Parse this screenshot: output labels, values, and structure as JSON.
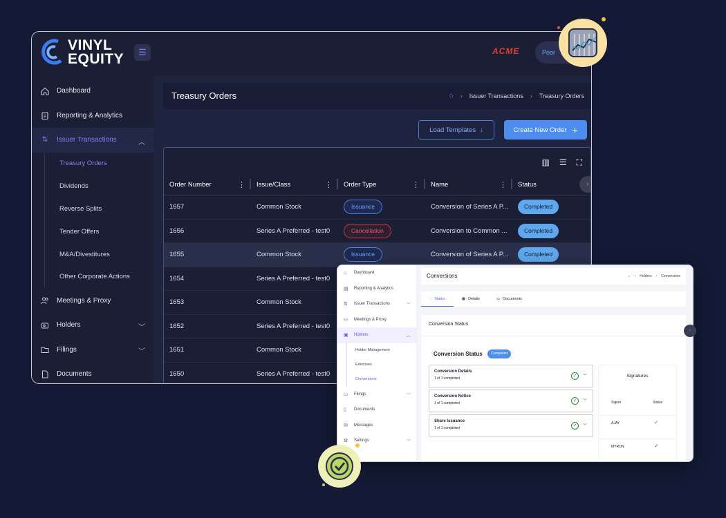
{
  "app": {
    "logo_line1": "VINYL",
    "logo_line2": "EQUITY",
    "client_brand": "ACME",
    "user_label": "Poor"
  },
  "sidebar": {
    "items": [
      {
        "label": "Dashboard",
        "icon": "home-icon"
      },
      {
        "label": "Reporting & Analytics",
        "icon": "clipboard-icon"
      },
      {
        "label": "Issuer Transactions",
        "icon": "transfer-arrows-icon",
        "expanded": true
      },
      {
        "label": "Meetings & Proxy",
        "icon": "people-icon"
      },
      {
        "label": "Holders",
        "icon": "holders-icon"
      },
      {
        "label": "Filings",
        "icon": "folder-icon"
      },
      {
        "label": "Documents",
        "icon": "document-icon"
      }
    ],
    "issuer_sub": [
      "Treasury Orders",
      "Dividends",
      "Reverse Splits",
      "Tender Offers",
      "M&A/Divestitures",
      "Other Corporate Actions"
    ]
  },
  "page": {
    "title": "Treasury Orders",
    "breadcrumb": [
      "Issuer Transactions",
      "Treasury Orders"
    ],
    "load_templates": "Load Templates",
    "create_order": "Create New Order"
  },
  "table": {
    "columns": [
      "Order Number",
      "Issue/Class",
      "Order Type",
      "Name",
      "Status"
    ],
    "rows": [
      {
        "order": "1657",
        "issue": "Common Stock",
        "type": "Issuance",
        "name": "Conversion of Series A P...",
        "status": "Completed"
      },
      {
        "order": "1656",
        "issue": "Series A Preferred - test0",
        "type": "Cancellation",
        "name": "Conversion to Common ...",
        "status": "Completed"
      },
      {
        "order": "1655",
        "issue": "Common Stock",
        "type": "Issuance",
        "name": "Conversion of Series A P...",
        "status": "Completed"
      },
      {
        "order": "1654",
        "issue": "Series A Preferred - test0"
      },
      {
        "order": "1653",
        "issue": "Common Stock"
      },
      {
        "order": "1652",
        "issue": "Series A Preferred - test0"
      },
      {
        "order": "1651",
        "issue": "Common Stock"
      },
      {
        "order": "1650",
        "issue": "Series A Preferred - test0"
      }
    ]
  },
  "overlay": {
    "sidebar": [
      "Dashboard",
      "Reporting & Analytics",
      "Issuer Transactions",
      "Meetings & Proxy",
      "Holders",
      "Filings",
      "Documents",
      "Messages",
      "Settings"
    ],
    "holders_sub": [
      "Holder Management",
      "Exercises",
      "Conversions"
    ],
    "title": "Conversions",
    "breadcrumb": [
      "Holders",
      "Conversions"
    ],
    "tabs": [
      "Status",
      "Details",
      "Documents"
    ],
    "section_title": "Conversion Status",
    "status_title": "Conversion Status",
    "status_badge": "Completed",
    "steps": [
      {
        "title": "Conversion Details",
        "sub": "1 of 1 completed"
      },
      {
        "title": "Conversion Notice",
        "sub": "1 of 1 completed"
      },
      {
        "title": "Share Issuance",
        "sub": "1 of 1 completed"
      }
    ],
    "signatures": {
      "title": "Signatures",
      "col_signer": "Signer",
      "col_status": "Status",
      "signers": [
        "AJAY",
        "MYRON"
      ]
    }
  },
  "colors": {
    "accent": "#8b7df5",
    "primary": "#4d8df0",
    "completed": "#5fa8ee",
    "cancel": "#ef5a52",
    "bg": "#141a35"
  }
}
